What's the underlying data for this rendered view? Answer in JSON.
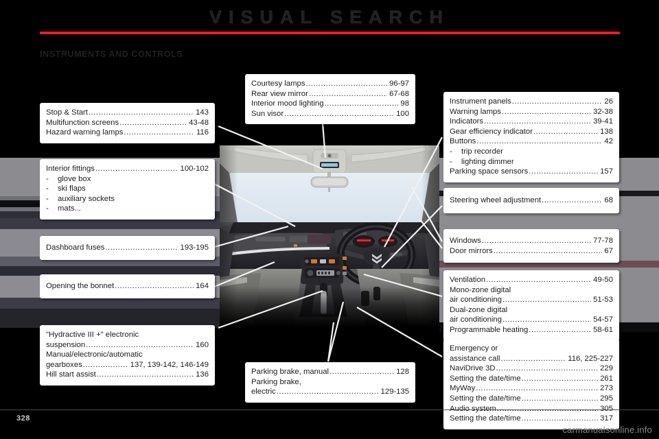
{
  "header": {
    "title": "VISUAL SEARCH",
    "section": "INSTRUMENTS AND CONTROLS",
    "rule_color": "#ed1c24"
  },
  "footer": {
    "page_number": "328",
    "watermark": "carmanualsonline.info"
  },
  "callouts": [
    {
      "id": "stop-start",
      "rows": [
        {
          "label": "Stop & Start",
          "page": "143"
        },
        {
          "label": "Multifunction screens",
          "page": "43-48"
        },
        {
          "label": "Hazard warning lamps",
          "page": "116"
        }
      ]
    },
    {
      "id": "interior-fittings",
      "rows": [
        {
          "label": "Interior fittings",
          "page": "100-102"
        }
      ],
      "bullets": [
        "glove box",
        "ski flaps",
        "auxiliary sockets",
        "mats..."
      ],
      "bullet_dash": "-"
    },
    {
      "id": "dashboard-fuses",
      "rows": [
        {
          "label": "Dashboard fuses",
          "page": "193-195"
        }
      ]
    },
    {
      "id": "opening-the-bonnet",
      "rows": [
        {
          "label": "Opening the bonnet",
          "page": "164"
        }
      ]
    },
    {
      "id": "suspension-gearboxes",
      "lead": "\"Hydractive III +\" electronic",
      "rows": [
        {
          "label": "suspension",
          "page": "160"
        }
      ],
      "lead2": "Manual/electronic/automatic",
      "rows2": [
        {
          "label": "gearboxes",
          "page": "137, 139-142, 146-149"
        },
        {
          "label": "Hill start assist",
          "page": "136"
        }
      ]
    },
    {
      "id": "courtesy-lamps",
      "rows": [
        {
          "label": "Courtesy lamps",
          "page": "96-97"
        },
        {
          "label": "Rear view mirror",
          "page": "67-68"
        },
        {
          "label": "Interior mood lighting",
          "page": "98"
        },
        {
          "label": "Sun visor",
          "page": "100"
        }
      ]
    },
    {
      "id": "parking-brake",
      "rows": [
        {
          "label": "Parking brake, manual",
          "page": "128"
        }
      ],
      "lead2": "Parking brake,",
      "rows2": [
        {
          "label": "electric",
          "page": "129-135"
        }
      ]
    },
    {
      "id": "instrument-panels",
      "rows": [
        {
          "label": "Instrument panels",
          "page": "26"
        },
        {
          "label": "Warning lamps",
          "page": "32-38"
        },
        {
          "label": "Indicators",
          "page": "39-41"
        },
        {
          "label": "Gear efficiency indicator",
          "page": "138"
        },
        {
          "label": "Buttons",
          "page": "42"
        }
      ],
      "bullets": [
        "trip recorder",
        "lighting dimmer"
      ],
      "bullet_dash": "-",
      "rows_after": [
        {
          "label": "Parking space sensors",
          "page": "157"
        }
      ]
    },
    {
      "id": "steering-wheel",
      "rows": [
        {
          "label": "Steering wheel adjustment",
          "page": "68"
        }
      ]
    },
    {
      "id": "windows-door-mirrors",
      "rows": [
        {
          "label": "Windows",
          "page": "77-78"
        },
        {
          "label": "Door mirrors",
          "page": "67"
        }
      ]
    },
    {
      "id": "ventilation",
      "rows": [
        {
          "label": "Ventilation",
          "page": "49-50"
        }
      ],
      "lead2": "Mono-zone digital",
      "rows2": [
        {
          "label": "air conditioning",
          "page": "51-53"
        }
      ],
      "lead3": "Dual-zone digital",
      "rows3": [
        {
          "label": "air conditioning",
          "page": "54-57"
        },
        {
          "label": "Programmable heating",
          "page": "58-61"
        }
      ]
    },
    {
      "id": "emergency-call",
      "lead": "Emergency or",
      "rows": [
        {
          "label": "assistance call",
          "page": "116, 225-227"
        },
        {
          "label": "NaviDrive 3D",
          "page": "229"
        },
        {
          "label": "Setting the date/time",
          "page": "261"
        },
        {
          "label": "MyWay",
          "page": "273"
        },
        {
          "label": "Setting the date/time",
          "page": "295"
        },
        {
          "label": "Audio system",
          "page": "305"
        },
        {
          "label": "Setting the date/time",
          "page": "317"
        }
      ]
    }
  ],
  "illustration": {
    "name": "car-dashboard-interior",
    "description": "Right-hand-drive car interior dashboard view"
  }
}
